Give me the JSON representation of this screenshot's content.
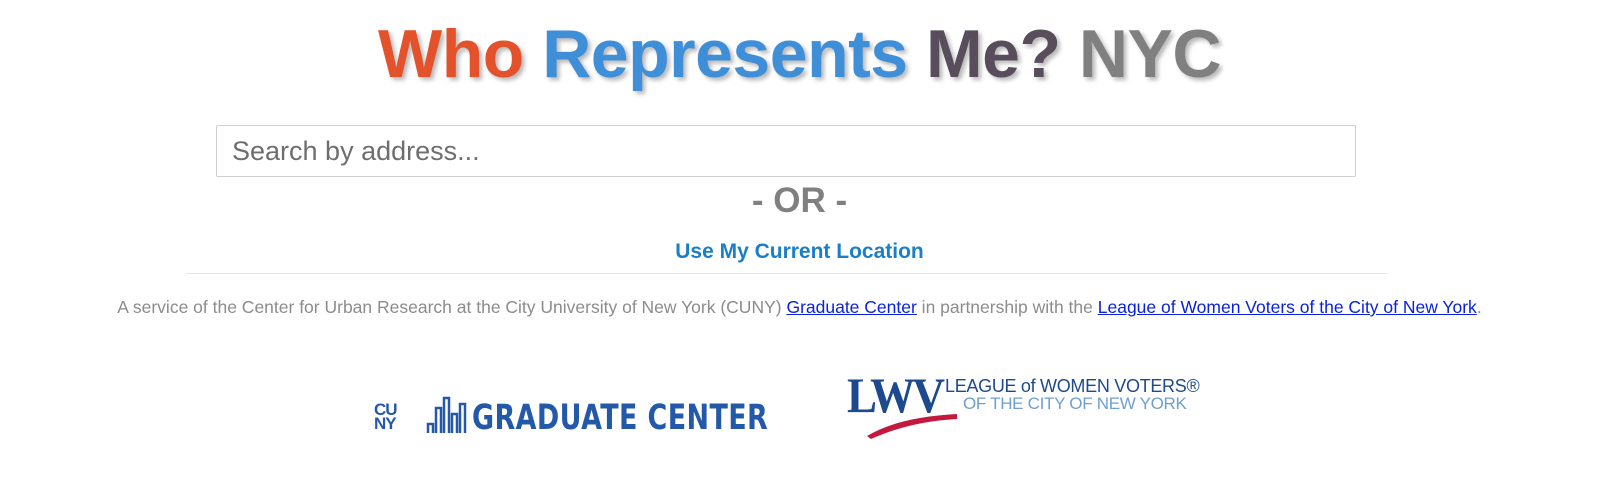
{
  "header": {
    "title_part1": "Who",
    "title_part2": "Represents",
    "title_part3": "Me?",
    "title_part4": "NYC"
  },
  "search": {
    "placeholder": "Search by address...",
    "value": ""
  },
  "or_separator": "- OR -",
  "location_button": "Use My Current Location",
  "credit": {
    "text_before": "A service of the Center for Urban Research at the City University of New York (CUNY) ",
    "link1": "Graduate Center",
    "text_middle": " in partnership with the ",
    "link2": "League of Women Voters of the City of New York",
    "text_after": "."
  },
  "logos": {
    "cuny_text": "CUNY",
    "gc_text": "GRADUATE CENTER",
    "gc_icon": "building-bars-icon",
    "lwv_mark": "LWV",
    "lwv_line1": "LEAGUE of WOMEN VOTERS®",
    "lwv_line2": "OF THE CITY OF NEW YORK"
  },
  "colors": {
    "title_who": "#e3522a",
    "title_represents": "#3e8ed8",
    "title_me": "#584d5b",
    "title_nyc": "#808080",
    "link": "#0a21e0",
    "location_link": "#1a7fc8",
    "cuny_blue": "#2459a9",
    "lwv_red": "#c4183c"
  }
}
